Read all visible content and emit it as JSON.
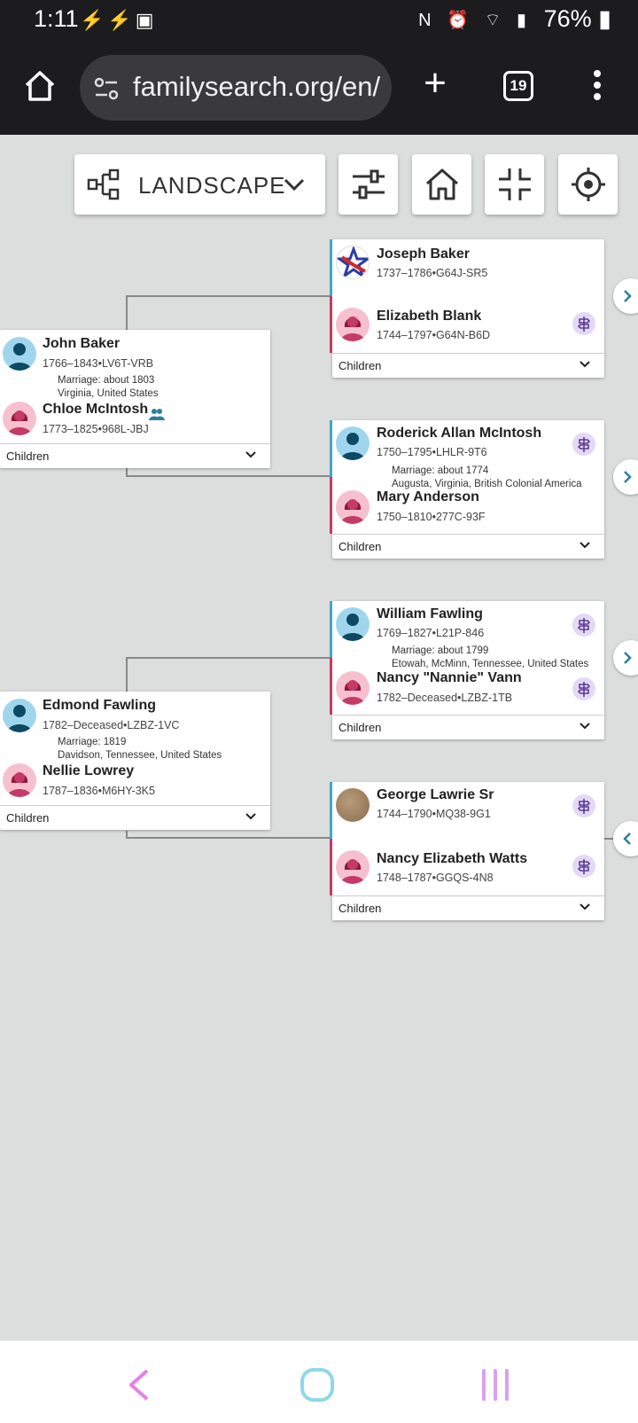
{
  "status": {
    "time": "1:11",
    "battery": "76%"
  },
  "browser": {
    "url": "familysearch.org/en/",
    "tab_count": "19"
  },
  "toolbar": {
    "layout_label": "LANDSCAPE"
  },
  "tree": {
    "children_label": "Children",
    "couples": {
      "baker": {
        "husband": {
          "name": "John Baker",
          "meta": "1766–1843•LV6T-VRB"
        },
        "marriage_date": "Marriage: about 1803",
        "marriage_place": "Virginia, United States",
        "wife": {
          "name": "Chloe McIntosh",
          "meta": "1773–1825•968L-JBJ"
        }
      },
      "fawling": {
        "husband": {
          "name": "Edmond Fawling",
          "meta": "1782–Deceased•LZBZ-1VC"
        },
        "marriage_date": "Marriage: 1819",
        "marriage_place": "Davidson, Tennessee, United States",
        "wife": {
          "name": "Nellie Lowrey",
          "meta": "1787–1836•M6HY-3K5"
        }
      },
      "joseph": {
        "husband": {
          "name": "Joseph Baker",
          "meta": "1737–1786•G64J-SR5"
        },
        "wife": {
          "name": "Elizabeth Blank",
          "meta": "1744–1797•G64N-B6D"
        }
      },
      "roderick": {
        "husband": {
          "name": "Roderick Allan McIntosh",
          "meta": "1750–1795•LHLR-9T6"
        },
        "marriage_date": "Marriage: about 1774",
        "marriage_place": "Augusta, Virginia, British Colonial America",
        "wife": {
          "name": "Mary Anderson",
          "meta": "1750–1810•277C-93F"
        }
      },
      "william": {
        "husband": {
          "name": "William Fawling",
          "meta": "1769–1827•L21P-846"
        },
        "marriage_date": "Marriage: about 1799",
        "marriage_place": "Etowah, McMinn, Tennessee, United States",
        "wife": {
          "name": "Nancy \"Nannie\" Vann",
          "meta": "1782–Deceased•LZBZ-1TB"
        }
      },
      "george": {
        "husband": {
          "name": "George Lawrie Sr",
          "meta": "1744–1790•MQ38-9G1"
        },
        "wife": {
          "name": "Nancy Elizabeth Watts",
          "meta": "1748–1787•GGQS-4N8"
        }
      }
    }
  },
  "colors": {
    "male": "#3fa9c4",
    "female": "#c83a64",
    "badge": "#e4d9f5"
  }
}
